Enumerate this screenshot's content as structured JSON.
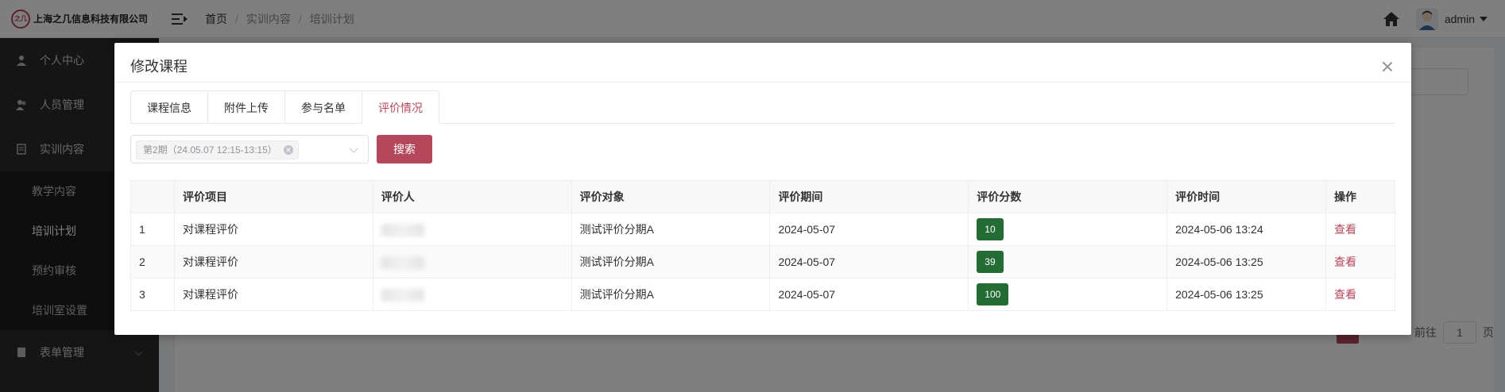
{
  "app": {
    "logo_mark": "之几",
    "company_name": "上海之几信息科技有限公司",
    "breadcrumb": [
      "首页",
      "实训内容",
      "培训计划"
    ],
    "user_name": "admin"
  },
  "sidebar": {
    "items": [
      {
        "label": "个人中心",
        "icon": "user-icon"
      },
      {
        "label": "人员管理",
        "icon": "users-icon"
      },
      {
        "label": "实训内容",
        "icon": "document-icon"
      }
    ],
    "sub_items": [
      "教学内容",
      "培训计划",
      "预约审核",
      "培训室设置"
    ],
    "bottom_item": {
      "label": "表单管理",
      "icon": "form-icon"
    }
  },
  "pager": {
    "goto_label": "前往",
    "page_value": "1",
    "page_suffix": "页"
  },
  "modal": {
    "title": "修改课程",
    "tabs": [
      {
        "label": "课程信息",
        "active": false
      },
      {
        "label": "附件上传",
        "active": false
      },
      {
        "label": "参与名单",
        "active": false
      },
      {
        "label": "评价情况",
        "active": true
      }
    ],
    "filter": {
      "selected_tag": "第2期（24.05.07 12:15-13:15）"
    },
    "search_label": "搜索",
    "table": {
      "headers": [
        "",
        "评价项目",
        "评价人",
        "评价对象",
        "评价期间",
        "评价分数",
        "评价时间",
        "操作"
      ],
      "rows": [
        {
          "index": "1",
          "item": "对课程评价",
          "target": "测试评价分期A",
          "period": "2024-05-07",
          "score": "10",
          "time": "2024-05-06 13:24",
          "action": "查看"
        },
        {
          "index": "2",
          "item": "对课程评价",
          "target": "测试评价分期A",
          "period": "2024-05-07",
          "score": "39",
          "time": "2024-05-06 13:25",
          "action": "查看"
        },
        {
          "index": "3",
          "item": "对课程评价",
          "target": "测试评价分期A",
          "period": "2024-05-07",
          "score": "100",
          "time": "2024-05-06 13:25",
          "action": "查看"
        }
      ]
    }
  },
  "colors": {
    "accent": "#b5475a",
    "score_badge": "#246b34",
    "sidebar_bg": "#2b2b2b"
  }
}
